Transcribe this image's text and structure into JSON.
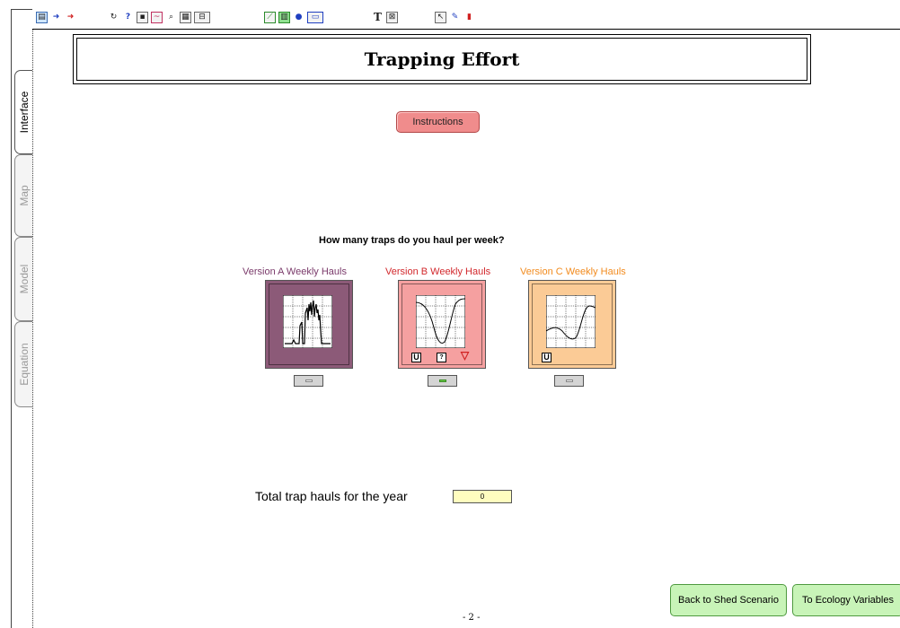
{
  "toolbar": {
    "groups": [
      {
        "name": "navigation",
        "icons": [
          "page-icon",
          "arrow-right-icon",
          "arrow-red-icon"
        ]
      },
      {
        "name": "building-blocks",
        "icons": [
          "loop-icon",
          "help-icon",
          "stock-icon",
          "graph-icon",
          "zoom-icon",
          "table-icon",
          "list-icon"
        ]
      },
      {
        "name": "output",
        "icons": [
          "chart-icon",
          "bar-icon",
          "knob-icon",
          "slider-icon"
        ]
      },
      {
        "name": "text",
        "icons": [
          "text-icon",
          "picture-icon"
        ]
      },
      {
        "name": "tools",
        "icons": [
          "pointer-icon",
          "paintbrush-icon",
          "dynamite-icon"
        ]
      }
    ],
    "text_tool_glyph": "T"
  },
  "side_tabs": [
    {
      "label": "Interface",
      "active": true
    },
    {
      "label": "Map",
      "active": false
    },
    {
      "label": "Model",
      "active": false
    },
    {
      "label": "Equation",
      "active": false
    }
  ],
  "title": "Trapping Effort",
  "instructions_label": "Instructions",
  "question": "How many traps do you haul per week?",
  "versions": [
    {
      "label": "Version A Weekly Hauls",
      "label_color": "#7a3a6a",
      "panel_color": "#8c5a78",
      "switch_on": false,
      "badges": []
    },
    {
      "label": "Version B Weekly Hauls",
      "label_color": "#d2282c",
      "panel_color": "#f5a0a0",
      "switch_on": true,
      "badges": [
        "U",
        "?",
        "▽"
      ]
    },
    {
      "label": "Version C Weekly Hauls",
      "label_color": "#f28b1e",
      "panel_color": "#fbcb96",
      "switch_on": false,
      "badges": [
        "U"
      ]
    }
  ],
  "total": {
    "label": "Total trap hauls for the year",
    "value": "0"
  },
  "nav": {
    "back": "Back to Shed Scenario",
    "forward": "To Ecology Variables"
  },
  "page_number": "- 2 -"
}
